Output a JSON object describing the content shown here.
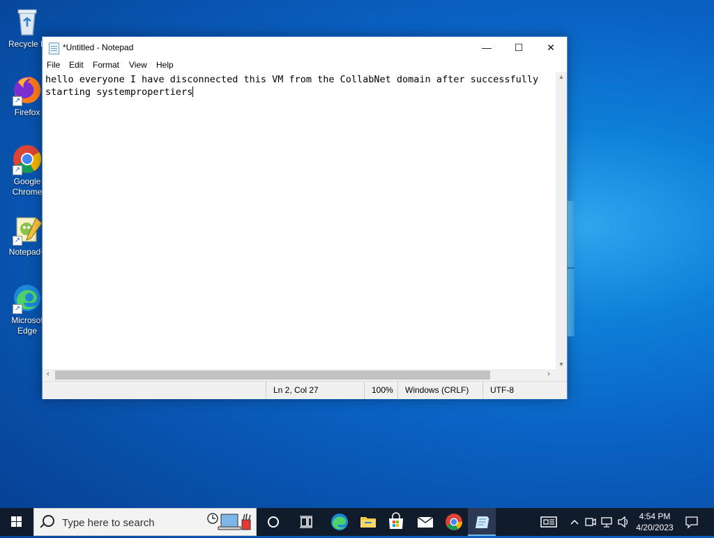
{
  "desktop": {
    "icons": [
      {
        "label": "Recycle B",
        "icon": "recycle-bin-icon"
      },
      {
        "label": "Firefox",
        "icon": "firefox-icon"
      },
      {
        "label": "Google\nChrome",
        "icon": "chrome-icon"
      },
      {
        "label": "Notepad+",
        "icon": "notepad-plus-plus-icon"
      },
      {
        "label": "Microsof\nEdge",
        "icon": "edge-icon"
      }
    ]
  },
  "window": {
    "title": "*Untitled - Notepad",
    "controls": {
      "minimize": "—",
      "maximize": "☐",
      "close": "✕"
    },
    "menu": [
      "File",
      "Edit",
      "Format",
      "View",
      "Help"
    ],
    "content": {
      "line1": "hello everyone I have disconnected this VM from the CollabNet domain after successfully",
      "line2": "starting systempropertiers"
    },
    "status": {
      "position": "Ln 2, Col 27",
      "zoom": "100%",
      "line_ending": "Windows (CRLF)",
      "encoding": "UTF-8"
    }
  },
  "taskbar": {
    "search_placeholder": "Type here to search",
    "apps": [
      "task-view",
      "edge",
      "file-explorer",
      "store",
      "mail",
      "chrome",
      "notepad"
    ],
    "clock": {
      "time": "4:54 PM",
      "date": "4/20/2023"
    }
  },
  "colors": {
    "taskbar": "#101b2c",
    "window_border": "#5b8ad6",
    "desktop_blue": "#0a62c4"
  }
}
